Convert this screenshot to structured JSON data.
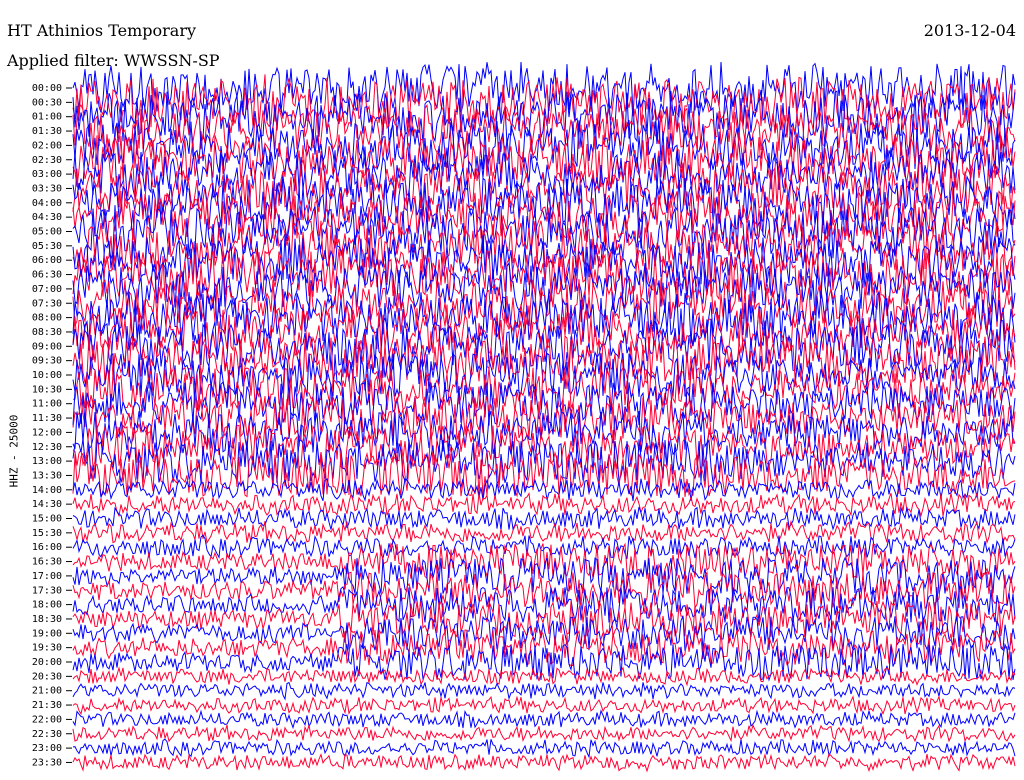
{
  "header": {
    "station": "HT Athinios Temporary",
    "filter": "Applied filter: WWSSN-SP",
    "date": "2013-12-04"
  },
  "chart_data": {
    "type": "helicorder",
    "channel_label": "HHZ - 25000",
    "tick_labels": [
      "00:00",
      "00:30",
      "01:00",
      "01:30",
      "02:00",
      "02:30",
      "03:00",
      "03:30",
      "04:00",
      "04:30",
      "05:00",
      "05:30",
      "06:00",
      "06:30",
      "07:00",
      "07:30",
      "08:00",
      "08:30",
      "09:00",
      "09:30",
      "10:00",
      "10:30",
      "11:00",
      "11:30",
      "12:00",
      "12:30",
      "13:00",
      "13:30",
      "14:00",
      "14:30",
      "15:00",
      "15:30",
      "16:00",
      "16:30",
      "17:00",
      "17:30",
      "18:00",
      "18:30",
      "19:00",
      "19:30",
      "20:00",
      "20:30",
      "21:00",
      "21:30",
      "22:00",
      "22:30",
      "23:00",
      "23:30"
    ],
    "trace_colors": [
      "#0000ff",
      "#ff0033"
    ],
    "grid": false,
    "legend": "none"
  }
}
